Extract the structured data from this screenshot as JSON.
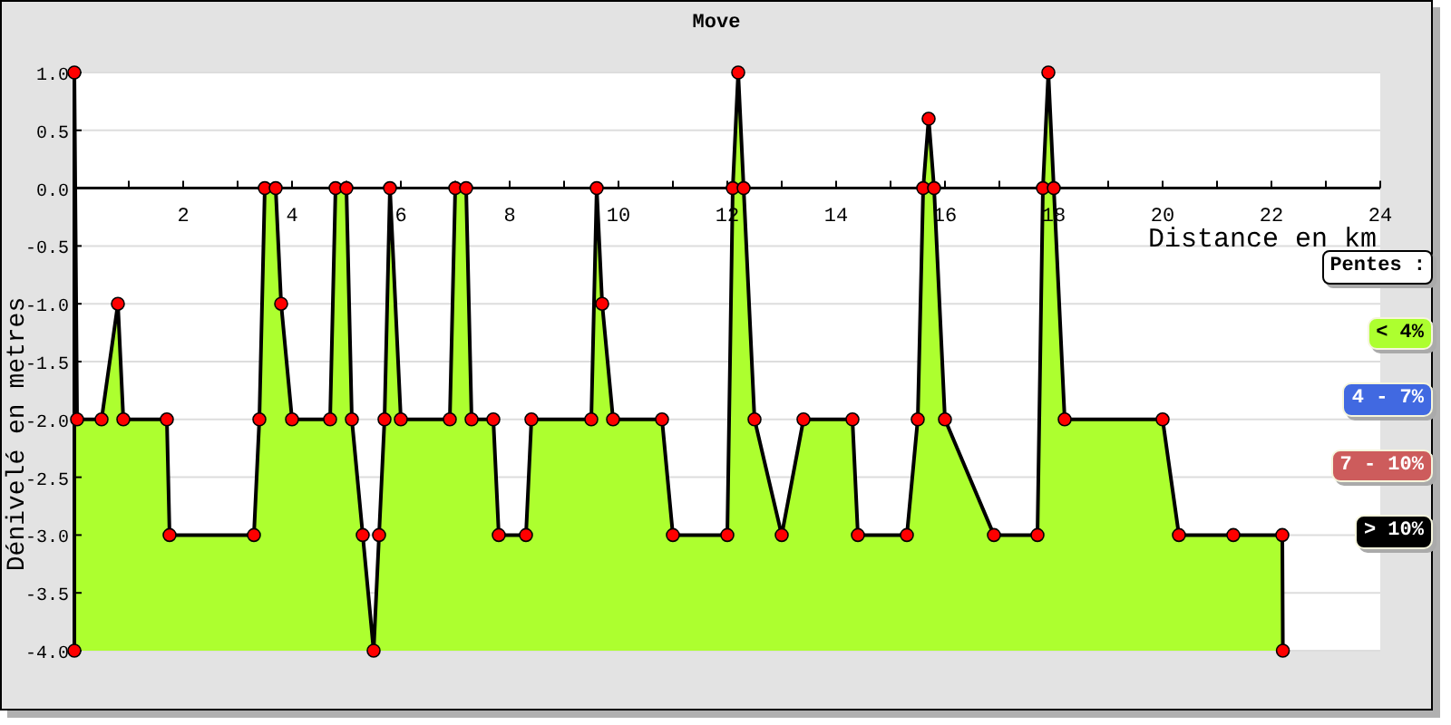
{
  "title": "Move",
  "chart_data": {
    "type": "area",
    "xlabel": "Distance en km",
    "ylabel": "Dénivelé en metres",
    "grid": true,
    "x": [
      0,
      0,
      0.05,
      0.5,
      0.8,
      0.9,
      1.7,
      1.75,
      3.3,
      3.4,
      3.5,
      3.7,
      3.8,
      4.0,
      4.7,
      4.8,
      5.0,
      5.1,
      5.3,
      5.5,
      5.6,
      5.7,
      5.8,
      6.0,
      6.9,
      7.0,
      7.2,
      7.3,
      7.7,
      7.8,
      8.3,
      8.4,
      9.5,
      9.6,
      9.7,
      9.9,
      10.8,
      11.0,
      12.0,
      12.1,
      12.2,
      12.3,
      12.5,
      13.0,
      13.4,
      14.3,
      14.4,
      15.3,
      15.5,
      15.6,
      15.7,
      15.8,
      16.0,
      16.9,
      17.7,
      17.8,
      17.9,
      18.0,
      18.2,
      20.0,
      20.3,
      21.3,
      22.2,
      22.21
    ],
    "series": [
      {
        "color": "#adff2f",
        "values": [
          -4,
          1,
          -2,
          -2,
          -1,
          -2,
          -2,
          -3,
          -3,
          -2,
          0,
          0,
          -1,
          -2,
          -2,
          0,
          0,
          -2,
          -3,
          -4,
          -3,
          -2,
          0,
          -2,
          -2,
          0,
          0,
          -2,
          -2,
          -3,
          -3,
          -2,
          -2,
          0,
          -1,
          -2,
          -2,
          -3,
          -3,
          0,
          1,
          0,
          -2,
          -3,
          -2,
          -2,
          -3,
          -3,
          -2,
          0,
          0.6,
          0,
          -2,
          -3,
          -3,
          0,
          1,
          0,
          -2,
          -2,
          -3,
          -3,
          -3,
          -4
        ]
      }
    ],
    "xlim": [
      0,
      24
    ],
    "ylim": [
      -4,
      1
    ],
    "xticks": [
      2,
      4,
      6,
      8,
      10,
      12,
      14,
      16,
      18,
      20,
      22,
      24
    ],
    "yticks": [
      {
        "value": 1,
        "label": "1.0"
      },
      {
        "value": 0.5,
        "label": "0.5"
      },
      {
        "value": 0,
        "label": "0.0"
      },
      {
        "value": -0.5,
        "label": "-0.5"
      },
      {
        "value": -1,
        "label": "-1.0"
      },
      {
        "value": -1.5,
        "label": "-1.5"
      },
      {
        "value": -2,
        "label": "-2.0"
      },
      {
        "value": -2.5,
        "label": "-2.5"
      },
      {
        "value": -3,
        "label": "-3.0"
      },
      {
        "value": -3.5,
        "label": "-3.5"
      },
      {
        "value": -4,
        "label": "-4.0"
      }
    ]
  },
  "legend": {
    "title": "Pentes :",
    "items": [
      {
        "label": "< 4%",
        "color": "#adff2f"
      },
      {
        "label": "4 - 7%",
        "color": "#4169e1"
      },
      {
        "label": "7 - 10%",
        "color": "#cd5c5c"
      },
      {
        "label": "> 10%",
        "color": "#000000"
      }
    ]
  }
}
